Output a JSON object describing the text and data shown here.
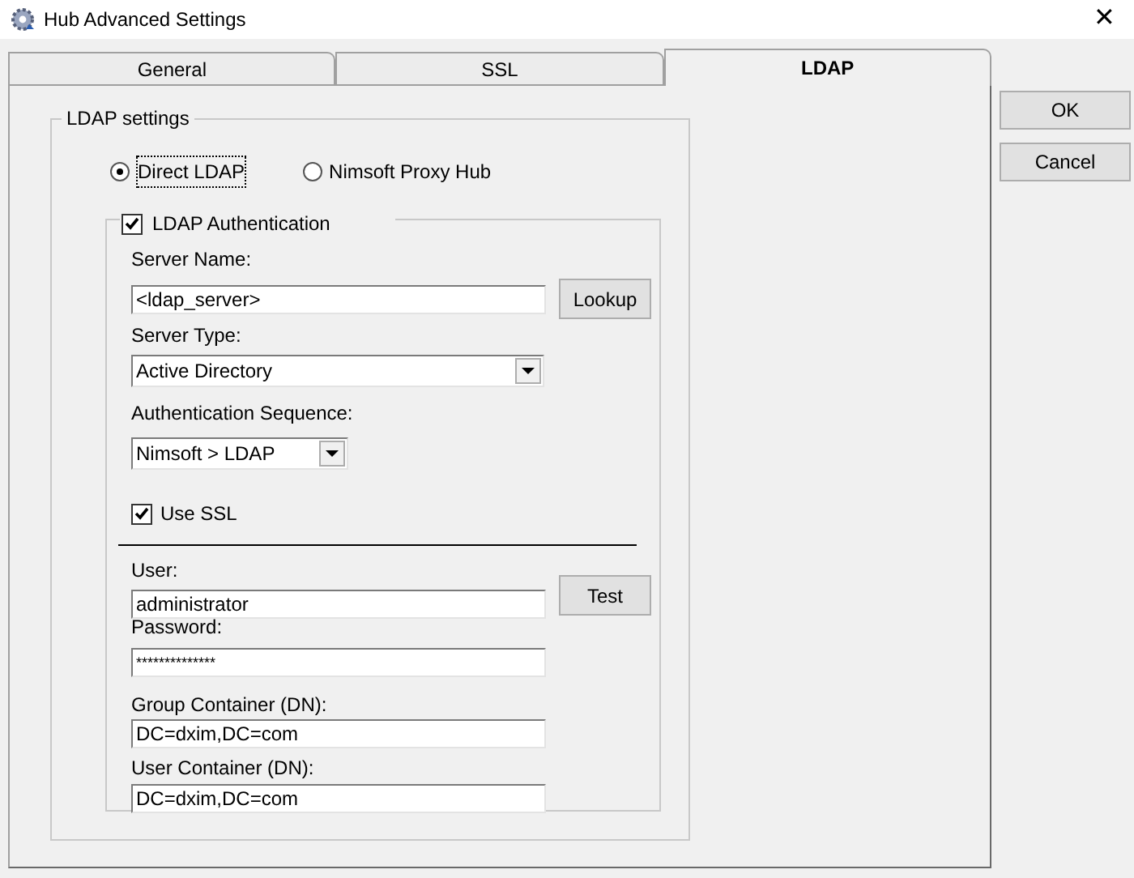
{
  "window": {
    "title": "Hub Advanced Settings",
    "close": "✕"
  },
  "tabs": [
    {
      "label": "General",
      "selected": false
    },
    {
      "label": "SSL",
      "selected": false
    },
    {
      "label": "LDAP",
      "selected": true
    }
  ],
  "buttons": [
    "OK",
    "Cancel"
  ],
  "ldap_settings": {
    "title": "LDAP settings",
    "mode": [
      {
        "label": "Direct LDAP",
        "selected": true
      },
      {
        "label": "Nimsoft Proxy Hub",
        "selected": false
      }
    ],
    "ldap_authentication": {
      "label": "LDAP Authentication",
      "checked": true,
      "server_name": {
        "label": "Server Name:",
        "value": "<ldap_server>",
        "button": "Lookup"
      },
      "server_type": {
        "label": "Server Type:",
        "value": "Active Directory"
      },
      "authentication_sequence": {
        "label": "Authentication Sequence:",
        "value": "Nimsoft > LDAP"
      },
      "use_ssl": {
        "label": "Use SSL",
        "checked": true
      },
      "user": {
        "label": "User:",
        "value": "administrator",
        "button": "Test"
      },
      "password": {
        "label": "Password:",
        "value": "**************"
      },
      "group_container": {
        "label": "Group Container (DN):",
        "value": "DC=dxim,DC=com"
      },
      "user_container": {
        "label": "User Container (DN):",
        "value": "DC=dxim,DC=com"
      }
    }
  }
}
